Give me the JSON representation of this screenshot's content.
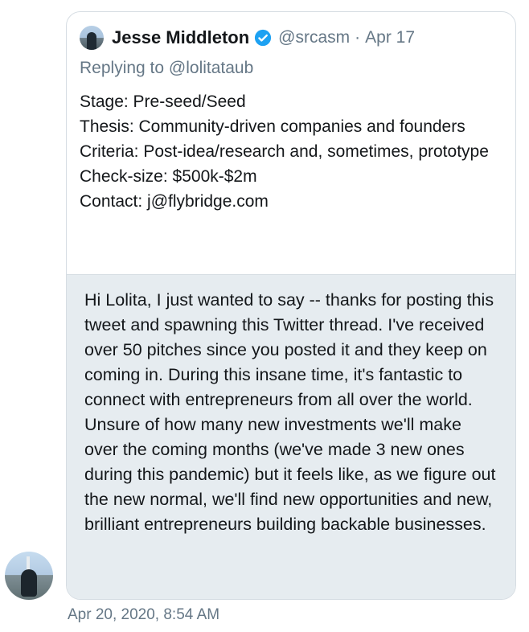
{
  "quoted_tweet": {
    "author_name": "Jesse Middleton",
    "handle": "@srcasm",
    "separator": "·",
    "date": "Apr 17",
    "replying_prefix": "Replying to",
    "replying_to": "@lolitataub",
    "lines": [
      "Stage: Pre-seed/Seed",
      "Thesis: Community-driven companies and founders",
      "Criteria: Post-idea/research and, sometimes, prototype",
      "Check-size: $500k-$2m",
      "Contact: j@flybridge.com"
    ]
  },
  "message": {
    "text": "Hi Lolita, I just wanted to say -- thanks for posting this tweet and spawning this Twitter thread. I've received over 50 pitches since you posted it and they keep on coming in. During this insane time, it's fantastic to connect with entrepreneurs from all over the world. Unsure of how many new investments we'll make over the coming months (we've made 3 new ones during this pandemic) but it feels like, as we figure out the new normal, we'll find new opportunities and new, brilliant entrepreneurs building backable businesses.",
    "timestamp": "Apr 20, 2020, 8:54 AM"
  },
  "colors": {
    "verified_blue": "#1da1f2",
    "muted_text": "#657786",
    "bubble_bg": "#e6ecf0"
  }
}
